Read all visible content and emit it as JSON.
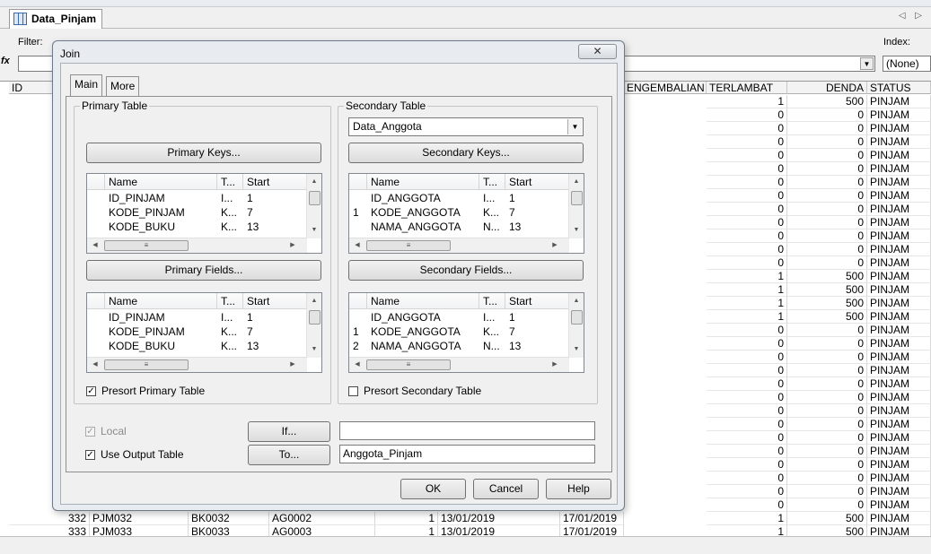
{
  "tab": {
    "title": "Data_Pinjam",
    "nav": "◁ ▷"
  },
  "filter": {
    "label": "Filter:",
    "value": "",
    "fx": "fx"
  },
  "index": {
    "label": "Index:",
    "value": "(None)"
  },
  "grid": {
    "headers": {
      "id": "ID",
      "pengembalian": "ENGEMBALIAN",
      "terlambat": "TERLAMBAT",
      "denda": "DENDA",
      "status": "STATUS"
    },
    "visible_rows": [
      {
        "terlambat": "1",
        "denda": "500",
        "status": "PINJAM"
      },
      {
        "terlambat": "0",
        "denda": "0",
        "status": "PINJAM"
      },
      {
        "terlambat": "0",
        "denda": "0",
        "status": "PINJAM"
      },
      {
        "terlambat": "0",
        "denda": "0",
        "status": "PINJAM"
      },
      {
        "terlambat": "0",
        "denda": "0",
        "status": "PINJAM"
      },
      {
        "terlambat": "0",
        "denda": "0",
        "status": "PINJAM"
      },
      {
        "terlambat": "0",
        "denda": "0",
        "status": "PINJAM"
      },
      {
        "terlambat": "0",
        "denda": "0",
        "status": "PINJAM"
      },
      {
        "terlambat": "0",
        "denda": "0",
        "status": "PINJAM"
      },
      {
        "terlambat": "0",
        "denda": "0",
        "status": "PINJAM"
      },
      {
        "terlambat": "0",
        "denda": "0",
        "status": "PINJAM"
      },
      {
        "terlambat": "0",
        "denda": "0",
        "status": "PINJAM"
      },
      {
        "terlambat": "0",
        "denda": "0",
        "status": "PINJAM"
      },
      {
        "terlambat": "1",
        "denda": "500",
        "status": "PINJAM"
      },
      {
        "terlambat": "1",
        "denda": "500",
        "status": "PINJAM"
      },
      {
        "terlambat": "1",
        "denda": "500",
        "status": "PINJAM"
      },
      {
        "terlambat": "1",
        "denda": "500",
        "status": "PINJAM"
      },
      {
        "terlambat": "0",
        "denda": "0",
        "status": "PINJAM"
      },
      {
        "terlambat": "0",
        "denda": "0",
        "status": "PINJAM"
      },
      {
        "terlambat": "0",
        "denda": "0",
        "status": "PINJAM"
      },
      {
        "terlambat": "0",
        "denda": "0",
        "status": "PINJAM"
      },
      {
        "terlambat": "0",
        "denda": "0",
        "status": "PINJAM"
      },
      {
        "terlambat": "0",
        "denda": "0",
        "status": "PINJAM"
      },
      {
        "terlambat": "0",
        "denda": "0",
        "status": "PINJAM"
      },
      {
        "terlambat": "0",
        "denda": "0",
        "status": "PINJAM"
      },
      {
        "terlambat": "0",
        "denda": "0",
        "status": "PINJAM"
      },
      {
        "terlambat": "0",
        "denda": "0",
        "status": "PINJAM"
      },
      {
        "terlambat": "0",
        "denda": "0",
        "status": "PINJAM"
      },
      {
        "terlambat": "0",
        "denda": "0",
        "status": "PINJAM"
      },
      {
        "terlambat": "0",
        "denda": "0",
        "status": "PINJAM"
      },
      {
        "terlambat": "0",
        "denda": "0",
        "status": "PINJAM"
      }
    ],
    "bottom_rows": [
      {
        "id": "332",
        "kode": "PJM032",
        "buku": "BK0032",
        "anggota": "AG0002",
        "qty": "1",
        "tgl_pinjam": "13/01/2019",
        "tgl_kembali": "17/01/2019",
        "terlambat": "1",
        "denda": "500",
        "status": "PINJAM"
      },
      {
        "id": "333",
        "kode": "PJM033",
        "buku": "BK0033",
        "anggota": "AG0003",
        "qty": "1",
        "tgl_pinjam": "13/01/2019",
        "tgl_kembali": "17/01/2019",
        "terlambat": "1",
        "denda": "500",
        "status": "PINJAM"
      }
    ]
  },
  "dialog": {
    "title": "Join",
    "close": "✕",
    "tabs": {
      "main": "Main",
      "more": "More"
    },
    "primary": {
      "group_label": "Primary Table",
      "keys_button": "Primary Keys...",
      "fields_button": "Primary Fields...",
      "columns": [
        "Name",
        "T...",
        "Start"
      ],
      "keys_rows": [
        {
          "mark": "",
          "name": "ID_PINJAM",
          "type": "I...",
          "start": "1"
        },
        {
          "mark": "",
          "name": "KODE_PINJAM",
          "type": "K...",
          "start": "7"
        },
        {
          "mark": "",
          "name": "KODE_BUKU",
          "type": "K...",
          "start": "13"
        }
      ],
      "fields_rows": [
        {
          "mark": "",
          "name": "ID_PINJAM",
          "type": "I...",
          "start": "1"
        },
        {
          "mark": "",
          "name": "KODE_PINJAM",
          "type": "K...",
          "start": "7"
        },
        {
          "mark": "",
          "name": "KODE_BUKU",
          "type": "K...",
          "start": "13"
        }
      ],
      "presort_label": "Presort Primary Table",
      "presort_checked": true
    },
    "secondary": {
      "group_label": "Secondary Table",
      "table_value": "Data_Anggota",
      "keys_button": "Secondary Keys...",
      "fields_button": "Secondary Fields...",
      "columns": [
        "Name",
        "T...",
        "Start"
      ],
      "keys_rows": [
        {
          "mark": "",
          "name": "ID_ANGGOTA",
          "type": "I...",
          "start": "1"
        },
        {
          "mark": "1",
          "name": "KODE_ANGGOTA",
          "type": "K...",
          "start": "7"
        },
        {
          "mark": "",
          "name": "NAMA_ANGGOTA",
          "type": "N...",
          "start": "13"
        }
      ],
      "fields_rows": [
        {
          "mark": "",
          "name": "ID_ANGGOTA",
          "type": "I...",
          "start": "1"
        },
        {
          "mark": "1",
          "name": "KODE_ANGGOTA",
          "type": "K...",
          "start": "7"
        },
        {
          "mark": "2",
          "name": "NAMA_ANGGOTA",
          "type": "N...",
          "start": "13"
        }
      ],
      "presort_label": "Presort Secondary Table",
      "presort_checked": false
    },
    "local_label": "Local",
    "use_output_label": "Use Output Table",
    "if_button": "If...",
    "to_button": "To...",
    "if_value": "",
    "to_value": "Anggota_Pinjam",
    "ok": "OK",
    "cancel": "Cancel",
    "help": "Help"
  }
}
